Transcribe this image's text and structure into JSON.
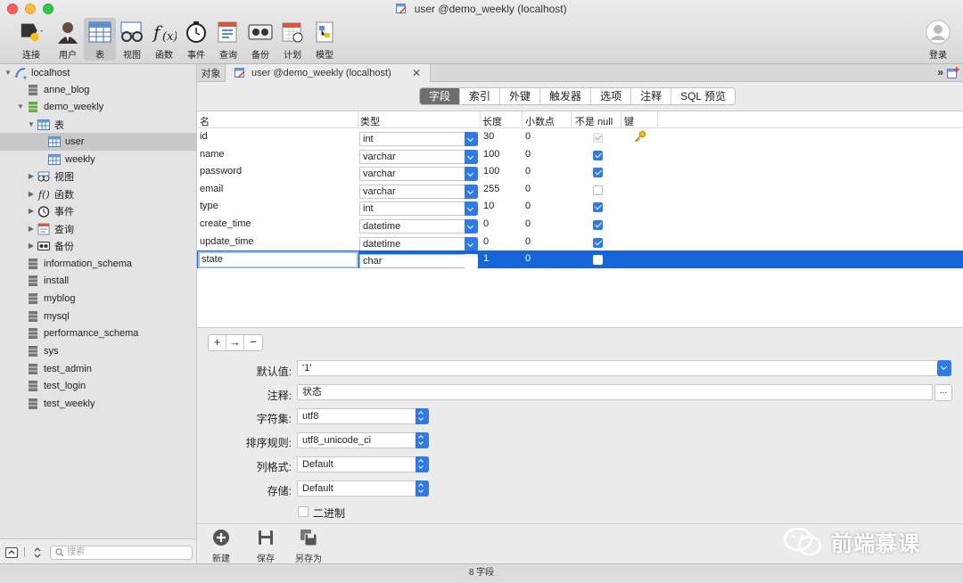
{
  "window": {
    "title": "user @demo_weekly (localhost)"
  },
  "toolbar": {
    "items": [
      {
        "label": "连接",
        "icon": "connect-icon"
      },
      {
        "label": "用户",
        "icon": "user-icon"
      },
      {
        "label": "表",
        "icon": "table-icon",
        "active": true
      },
      {
        "label": "视图",
        "icon": "view-icon"
      },
      {
        "label": "函数",
        "icon": "function-icon"
      },
      {
        "label": "事件",
        "icon": "event-icon"
      },
      {
        "label": "查询",
        "icon": "query-icon"
      },
      {
        "label": "备份",
        "icon": "backup-icon"
      },
      {
        "label": "计划",
        "icon": "schedule-icon"
      },
      {
        "label": "模型",
        "icon": "model-icon"
      }
    ],
    "login_label": "登录"
  },
  "sidebar": {
    "root": "localhost",
    "databases_before": [
      "anne_blog"
    ],
    "open_db": "demo_weekly",
    "tables_node": "表",
    "tables": [
      "user",
      "weekly"
    ],
    "subnodes": [
      "视图",
      "函数",
      "事件",
      "查询",
      "备份"
    ],
    "databases_after": [
      "information_schema",
      "install",
      "myblog",
      "mysql",
      "performance_schema",
      "sys",
      "test_admin",
      "test_login",
      "test_weekly"
    ],
    "search_placeholder": "搜索"
  },
  "tabs": {
    "objects_label": "对象",
    "current_label": "user @demo_weekly (localhost)"
  },
  "segments": [
    "字段",
    "索引",
    "外键",
    "触发器",
    "选项",
    "注释",
    "SQL 预览"
  ],
  "grid": {
    "headers": {
      "name": "名",
      "type": "类型",
      "length": "长度",
      "decimals": "小数点",
      "not_null": "不是 null",
      "key": "键"
    },
    "rows": [
      {
        "name": "id",
        "type": "int",
        "length": "30",
        "decimals": "0",
        "not_null": "disabled",
        "key": true
      },
      {
        "name": "name",
        "type": "varchar",
        "length": "100",
        "decimals": "0",
        "not_null": "checked",
        "key": false
      },
      {
        "name": "password",
        "type": "varchar",
        "length": "100",
        "decimals": "0",
        "not_null": "checked",
        "key": false
      },
      {
        "name": "email",
        "type": "varchar",
        "length": "255",
        "decimals": "0",
        "not_null": "unchecked",
        "key": false
      },
      {
        "name": "type",
        "type": "int",
        "length": "10",
        "decimals": "0",
        "not_null": "checked",
        "key": false
      },
      {
        "name": "create_time",
        "type": "datetime",
        "length": "0",
        "decimals": "0",
        "not_null": "checked",
        "key": false
      },
      {
        "name": "update_time",
        "type": "datetime",
        "length": "0",
        "decimals": "0",
        "not_null": "checked",
        "key": false
      },
      {
        "name": "state",
        "type": "char",
        "length": "1",
        "decimals": "0",
        "not_null": "checked",
        "key": false,
        "selected": true
      }
    ]
  },
  "row_buttons": [
    "+",
    "→",
    "−"
  ],
  "properties": {
    "default_label": "默认值:",
    "default_value": "'1'",
    "comment_label": "注释:",
    "comment_value": "状态",
    "comment_button": "...",
    "charset_label": "字符集:",
    "charset_value": "utf8",
    "collation_label": "排序规则:",
    "collation_value": "utf8_unicode_ci",
    "format_label": "列格式:",
    "format_value": "Default",
    "storage_label": "存储:",
    "storage_value": "Default",
    "binary_label": "二进制"
  },
  "bottom_buttons": {
    "new": "新建",
    "save": "保存",
    "save_as": "另存为"
  },
  "status": "8 字段",
  "watermark": "前端慕课",
  "colors": {
    "accent": "#2f7ae5",
    "selection": "#1565d8"
  }
}
